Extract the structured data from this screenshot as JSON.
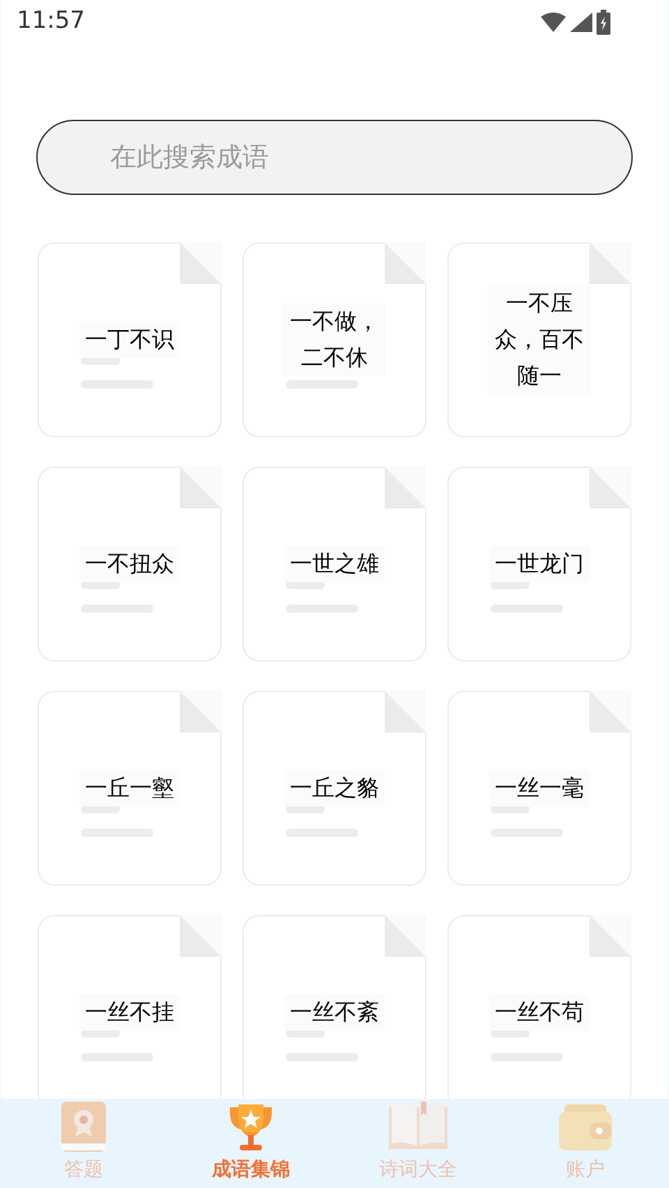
{
  "status_bar": {
    "time": "11:57"
  },
  "search": {
    "placeholder": "在此搜索成语"
  },
  "idioms": [
    {
      "text": "一丁不识"
    },
    {
      "text": "一不做，二不休"
    },
    {
      "text": "一不压众，百不随一"
    },
    {
      "text": "一不扭众"
    },
    {
      "text": "一世之雄"
    },
    {
      "text": "一世龙门"
    },
    {
      "text": "一丘一壑"
    },
    {
      "text": "一丘之貉"
    },
    {
      "text": "一丝一毫"
    },
    {
      "text": "一丝不挂"
    },
    {
      "text": "一丝不紊"
    },
    {
      "text": "一丝不苟"
    }
  ],
  "tabs": [
    {
      "label": "答题",
      "kind": "book",
      "selected": false
    },
    {
      "label": "成语集锦",
      "kind": "trophy",
      "selected": true
    },
    {
      "label": "诗词大全",
      "kind": "open-book",
      "selected": false
    },
    {
      "label": "账户",
      "kind": "wallet",
      "selected": false
    }
  ]
}
